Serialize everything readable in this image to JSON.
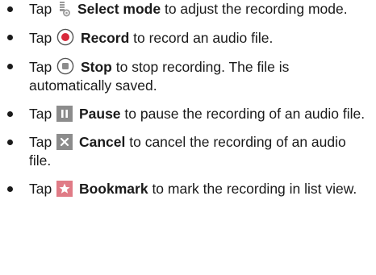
{
  "items": [
    {
      "prefix": "Tap",
      "icon": "select-mode-icon",
      "keyword": "Select mode",
      "text": "to adjust the recording mode."
    },
    {
      "prefix": "Tap",
      "icon": "record-icon",
      "keyword": "Record",
      "text": "to record an audio file."
    },
    {
      "prefix": "Tap",
      "icon": "stop-icon",
      "keyword": "Stop",
      "text": "to stop recording. The file is automatically saved."
    },
    {
      "prefix": "Tap",
      "icon": "pause-icon",
      "keyword": "Pause",
      "text": "to pause the recording of an audio file."
    },
    {
      "prefix": "Tap",
      "icon": "cancel-icon",
      "keyword": "Cancel",
      "text": "to cancel the recording of an audio file."
    },
    {
      "prefix": "Tap",
      "icon": "bookmark-icon",
      "keyword": "Bookmark",
      "text": "to mark the recording in list view."
    }
  ],
  "colors": {
    "text": "#1a1a1a",
    "record_red": "#d8293a",
    "icon_gray": "#8c8c8c",
    "icon_pink": "#e07b86"
  }
}
